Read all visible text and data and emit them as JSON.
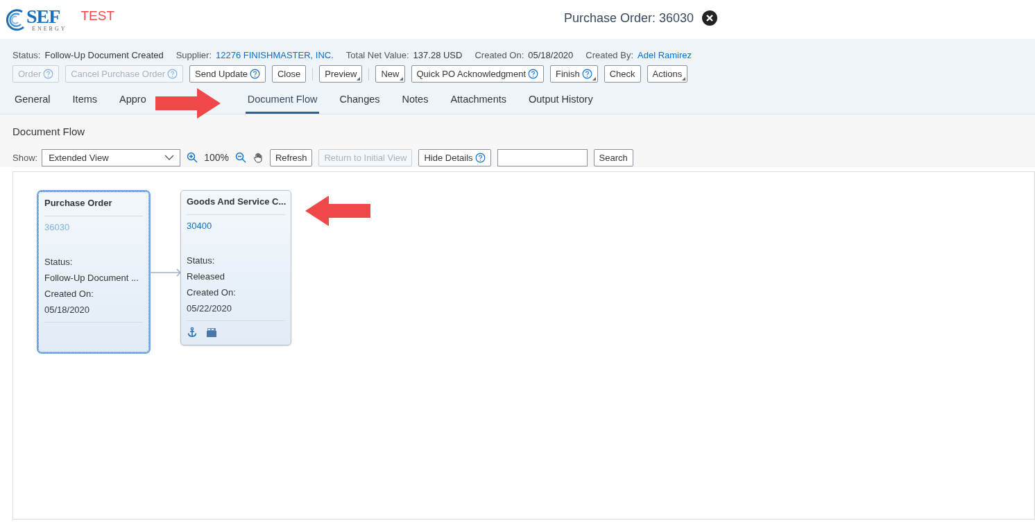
{
  "header": {
    "logo": {
      "word": "SEF",
      "tagline": "ENERGY"
    },
    "environment": "TEST",
    "title": "Purchase Order: 36030"
  },
  "facts": [
    {
      "label": "Status:",
      "value": "Follow-Up Document Created",
      "link": false
    },
    {
      "label": "Supplier:",
      "value": "12276 FINISHMASTER, INC.",
      "link": true
    },
    {
      "label": "Total Net Value:",
      "value": "137.28 USD",
      "link": false
    },
    {
      "label": "Created On:",
      "value": "05/18/2020",
      "link": false
    },
    {
      "label": "Created By:",
      "value": "Adel Ramirez",
      "link": true
    }
  ],
  "actions": [
    {
      "kind": "button",
      "label": "Order",
      "disabled": true,
      "menu": false,
      "help": true
    },
    {
      "kind": "button",
      "label": "Cancel Purchase Order",
      "disabled": true,
      "menu": false,
      "help": true
    },
    {
      "kind": "button",
      "label": "Send Update",
      "disabled": false,
      "menu": false,
      "help": true
    },
    {
      "kind": "button",
      "label": "Close",
      "disabled": false,
      "menu": false,
      "help": false
    },
    {
      "kind": "separator"
    },
    {
      "kind": "button",
      "label": "Preview",
      "disabled": false,
      "menu": true,
      "help": false
    },
    {
      "kind": "separator"
    },
    {
      "kind": "button",
      "label": "New",
      "disabled": false,
      "menu": true,
      "help": false
    },
    {
      "kind": "button",
      "label": "Quick PO Acknowledgment",
      "disabled": false,
      "menu": false,
      "help": true
    },
    {
      "kind": "button",
      "label": "Finish",
      "disabled": false,
      "menu": true,
      "help": true
    },
    {
      "kind": "button",
      "label": "Check",
      "disabled": false,
      "menu": false,
      "help": false
    },
    {
      "kind": "button",
      "label": "Actions",
      "disabled": false,
      "menu": true,
      "help": false
    }
  ],
  "tabs": [
    {
      "label": "General",
      "selected": false
    },
    {
      "label": "Items",
      "selected": false
    },
    {
      "label": "Appro",
      "selected": false
    },
    {
      "label": "Document Flow",
      "selected": true
    },
    {
      "label": "Changes",
      "selected": false
    },
    {
      "label": "Notes",
      "selected": false
    },
    {
      "label": "Attachments",
      "selected": false
    },
    {
      "label": "Output History",
      "selected": false
    }
  ],
  "section": {
    "title": "Document Flow",
    "toolbar": {
      "show_label": "Show:",
      "view": "Extended View",
      "zoom": "100%",
      "refresh": "Refresh",
      "reset": {
        "label": "Return to Initial View",
        "disabled": true
      },
      "details": "Hide Details",
      "search": "Search"
    },
    "nodes": [
      {
        "title": "Purchase Order",
        "number": "36030",
        "focused": true,
        "status_label": "Status:",
        "status": "Follow-Up Document ...",
        "created_label": "Created On:",
        "created": "05/18/2020",
        "icons": false
      },
      {
        "title": "Goods And Service C...",
        "number": "30400",
        "focused": false,
        "status_label": "Status:",
        "status": "Released",
        "created_label": "Created On:",
        "created": "05/22/2020",
        "icons": true
      }
    ]
  }
}
